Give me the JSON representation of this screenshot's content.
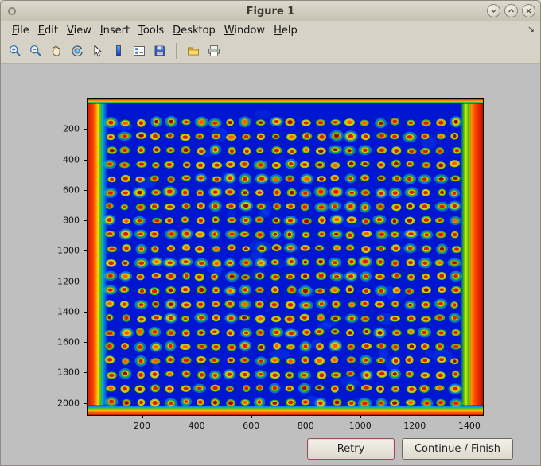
{
  "window": {
    "title": "Figure 1",
    "controls": {
      "menu_icon": "window-menu",
      "minimize_icon": "chevron-down",
      "maximize_icon": "chevron-up",
      "close_icon": "close-x"
    }
  },
  "menubar": {
    "items": [
      {
        "label": "File"
      },
      {
        "label": "Edit"
      },
      {
        "label": "View"
      },
      {
        "label": "Insert"
      },
      {
        "label": "Tools"
      },
      {
        "label": "Desktop"
      },
      {
        "label": "Window"
      },
      {
        "label": "Help"
      }
    ],
    "overflow_icon": "dock-arrow"
  },
  "toolbar": {
    "buttons": [
      {
        "name": "zoom-in"
      },
      {
        "name": "zoom-out"
      },
      {
        "name": "pan-hand"
      },
      {
        "name": "rotate-3d"
      },
      {
        "name": "data-cursor"
      },
      {
        "name": "insert-colorbar"
      },
      {
        "name": "insert-legend"
      },
      {
        "name": "save-figure"
      },
      {
        "name": "open-file"
      },
      {
        "name": "print-figure"
      }
    ]
  },
  "chart_data": {
    "type": "heatmap",
    "title": "",
    "xlabel": "",
    "ylabel": "",
    "description": "Microarray scan rendered with jet colormap: deep blue background, 21x24 grid of spots with red cores, yellow-orange rings and green rims, saturated red/orange bands along all image edges and a bright yellow-green vertical stripe just inside the right edge",
    "x_ticks": [
      200,
      400,
      600,
      800,
      1000,
      1200,
      1400
    ],
    "y_ticks": [
      200,
      400,
      600,
      800,
      1000,
      1200,
      1400,
      1600,
      1800,
      2000
    ],
    "x_range": [
      0,
      1450
    ],
    "y_range": [
      0,
      2080
    ],
    "y_direction": "down",
    "grid": false,
    "spots": {
      "rows": 21,
      "cols": 24,
      "x_start": 85,
      "x_step": 55,
      "y_start": 157,
      "y_step": 92,
      "radius_x_px": 5.6,
      "radius_y_px": 4.3
    },
    "colors": {
      "background": "#0016d0",
      "spot_core": "#d22000",
      "spot_core_dark": "#8c1000",
      "spot_core_hot": "#ff5a00",
      "spot_mid": "#ffc400",
      "spot_mid_alt": "#ff9000",
      "spot_rim": "#2db81e",
      "spot_rim_alt": "#8cd212",
      "spot_halo": "#18c8d8",
      "edge_red": "#c81e00",
      "edge_orange": "#ff9400",
      "edge_yellow": "#ffd800",
      "edge_green": "#3fc815",
      "edge_cyan": "#00a0e8",
      "stripe_green": "#39c415",
      "stripe_yellow": "#d8e800"
    },
    "seed": 7
  },
  "actions": {
    "retry_label": "Retry",
    "continue_label": "Continue / Finish"
  }
}
